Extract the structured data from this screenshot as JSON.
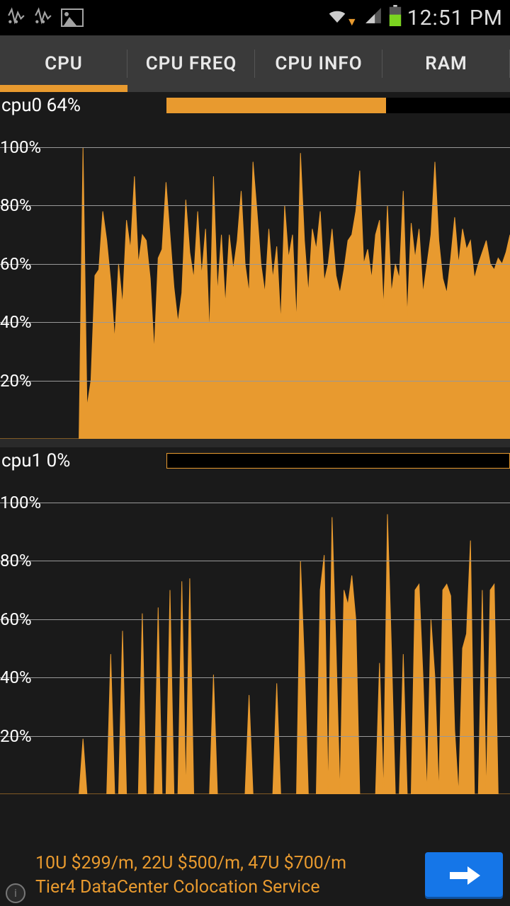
{
  "status_bar": {
    "time": "12:51 PM"
  },
  "tabs": [
    {
      "label": "CPU",
      "active": true
    },
    {
      "label": "CPU FREQ",
      "active": false
    },
    {
      "label": "CPU INFO",
      "active": false
    },
    {
      "label": "RAM",
      "active": false
    }
  ],
  "cpu0": {
    "label": "cpu0 64%",
    "bar_fill_pct": 64
  },
  "cpu1": {
    "label": "cpu1 0%",
    "bar_fill_pct": 0
  },
  "yticks": [
    "20%",
    "40%",
    "60%",
    "80%",
    "100%"
  ],
  "ad": {
    "line1": "10U $299/m, 22U $500/m, 47U $700/m",
    "line2": "Tier4 DataCenter Colocation Service"
  },
  "chart_data": [
    {
      "type": "area",
      "title": "cpu0 64%",
      "ylabel": "",
      "xlabel": "",
      "ylim": [
        0,
        100
      ],
      "yticks": [
        20,
        40,
        60,
        80,
        100
      ],
      "values": [
        0,
        0,
        0,
        0,
        0,
        0,
        0,
        0,
        0,
        0,
        0,
        0,
        0,
        0,
        0,
        0,
        0,
        0,
        0,
        0,
        0,
        100,
        11,
        20,
        56,
        58,
        78,
        68,
        54,
        34,
        60,
        46,
        75,
        65,
        90,
        60,
        70,
        68,
        55,
        30,
        62,
        65,
        88,
        70,
        52,
        40,
        50,
        82,
        64,
        55,
        78,
        56,
        72,
        36,
        90,
        50,
        70,
        46,
        70,
        58,
        68,
        85,
        60,
        50,
        95,
        78,
        60,
        50,
        72,
        55,
        66,
        40,
        80,
        62,
        70,
        40,
        98,
        68,
        50,
        72,
        65,
        78,
        54,
        60,
        72,
        56,
        50,
        58,
        68,
        70,
        78,
        92,
        60,
        65,
        55,
        70,
        75,
        45,
        80,
        50,
        60,
        55,
        85,
        42,
        74,
        62,
        72,
        50,
        60,
        70,
        95,
        68,
        55,
        50,
        62,
        76,
        60,
        72,
        65,
        68,
        55,
        60,
        64,
        68,
        60,
        58,
        62,
        60,
        64,
        70
      ]
    },
    {
      "type": "area",
      "title": "cpu1 0%",
      "ylabel": "",
      "xlabel": "",
      "ylim": [
        0,
        100
      ],
      "yticks": [
        20,
        40,
        60,
        80,
        100
      ],
      "values": [
        0,
        0,
        0,
        0,
        0,
        0,
        0,
        0,
        0,
        0,
        0,
        0,
        0,
        0,
        0,
        0,
        0,
        0,
        0,
        0,
        0,
        19,
        0,
        0,
        0,
        0,
        0,
        0,
        48,
        0,
        0,
        56,
        0,
        0,
        0,
        0,
        62,
        0,
        0,
        0,
        64,
        0,
        0,
        70,
        0,
        0,
        73,
        0,
        74,
        0,
        0,
        0,
        0,
        0,
        41,
        0,
        0,
        0,
        0,
        0,
        0,
        0,
        0,
        34,
        0,
        0,
        0,
        0,
        0,
        0,
        38,
        0,
        0,
        0,
        0,
        0,
        80,
        45,
        0,
        0,
        0,
        70,
        82,
        0,
        95,
        50,
        0,
        70,
        65,
        75,
        60,
        0,
        0,
        0,
        0,
        0,
        45,
        0,
        96,
        50,
        0,
        0,
        48,
        0,
        0,
        70,
        72,
        40,
        0,
        60,
        40,
        0,
        70,
        72,
        68,
        22,
        0,
        50,
        55,
        87,
        0,
        0,
        70,
        0,
        70,
        72,
        0,
        0,
        0,
        0
      ]
    }
  ]
}
